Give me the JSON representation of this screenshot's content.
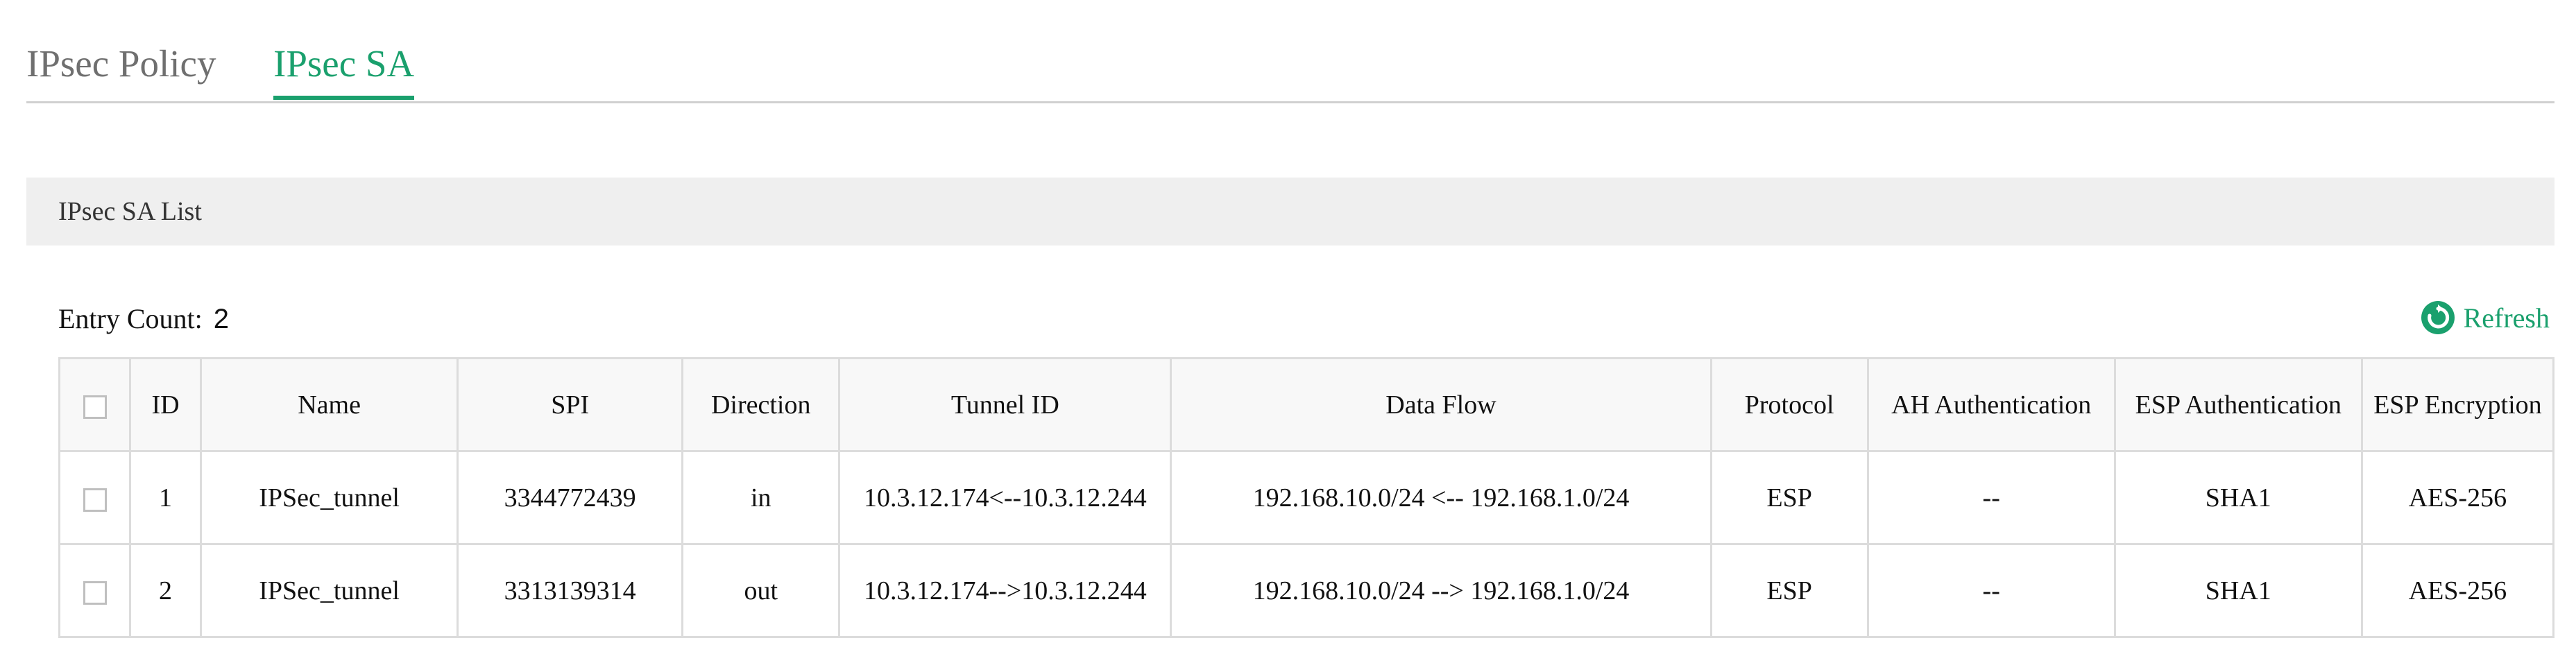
{
  "tabs": [
    {
      "label": "IPsec Policy",
      "active": false
    },
    {
      "label": "IPsec SA",
      "active": true
    }
  ],
  "section": {
    "title": "IPsec SA List"
  },
  "entry_count": {
    "label": "Entry Count:",
    "value": "2"
  },
  "refresh": {
    "label": "Refresh",
    "icon": "refresh-icon"
  },
  "colors": {
    "accent": "#1aa06d",
    "header_bg": "#efefef",
    "border": "#dcdcdc"
  },
  "table": {
    "columns": [
      "ID",
      "Name",
      "SPI",
      "Direction",
      "Tunnel ID",
      "Data Flow",
      "Protocol",
      "AH Authentication",
      "ESP Authentication",
      "ESP Encryption"
    ],
    "rows": [
      {
        "id": "1",
        "name": "IPSec_tunnel",
        "spi": "3344772439",
        "direction": "in",
        "tunnel_id": "10.3.12.174<--10.3.12.244",
        "data_flow": "192.168.10.0/24 <-- 192.168.1.0/24",
        "protocol": "ESP",
        "ah_auth": "--",
        "esp_auth": "SHA1",
        "esp_enc": "AES-256"
      },
      {
        "id": "2",
        "name": "IPSec_tunnel",
        "spi": "3313139314",
        "direction": "out",
        "tunnel_id": "10.3.12.174-->10.3.12.244",
        "data_flow": "192.168.10.0/24 --> 192.168.1.0/24",
        "protocol": "ESP",
        "ah_auth": "--",
        "esp_auth": "SHA1",
        "esp_enc": "AES-256"
      }
    ]
  }
}
